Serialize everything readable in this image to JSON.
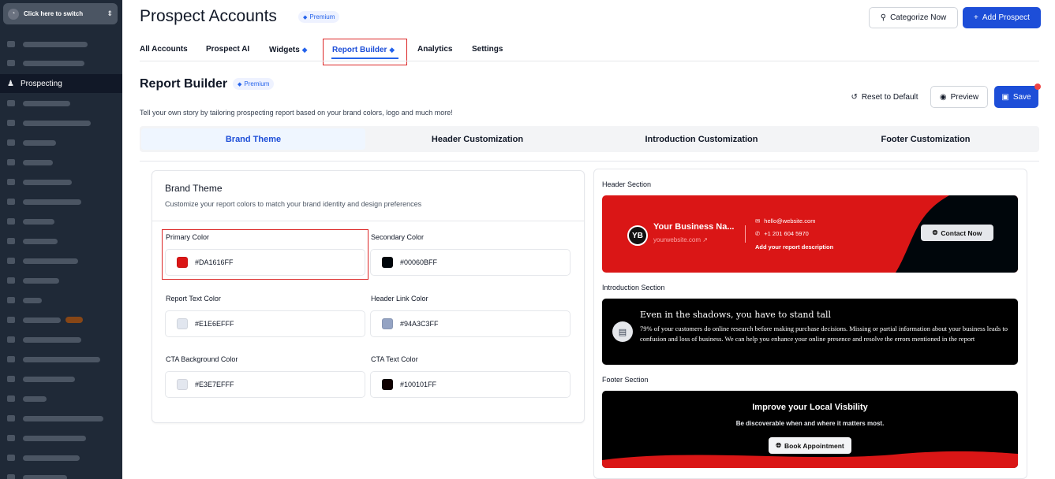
{
  "sidebar": {
    "switcher_label": "Click here to switch",
    "active_item": "Prospecting"
  },
  "page": {
    "title": "Prospect Accounts",
    "premium_badge": "Premium",
    "categorize_label": "Categorize Now",
    "add_prospect_label": "Add Prospect"
  },
  "tabs": [
    {
      "label": "All Accounts"
    },
    {
      "label": "Prospect AI"
    },
    {
      "label": "Widgets"
    },
    {
      "label": "Report Builder"
    },
    {
      "label": "Analytics"
    },
    {
      "label": "Settings"
    }
  ],
  "report_builder": {
    "title": "Report Builder",
    "premium_badge": "Premium",
    "description": "Tell your own story by tailoring prospecting report based on your brand colors, logo and much more!",
    "reset_label": "Reset to Default",
    "preview_label": "Preview",
    "save_label": "Save"
  },
  "subtabs": [
    {
      "label": "Brand Theme"
    },
    {
      "label": "Header Customization"
    },
    {
      "label": "Introduction Customization"
    },
    {
      "label": "Footer Customization"
    }
  ],
  "brand_theme": {
    "title": "Brand Theme",
    "subtitle": "Customize your report colors to match your brand identity and design preferences",
    "fields": [
      {
        "label": "Primary Color",
        "value": "#DA1616FF",
        "swatch": "#da1616"
      },
      {
        "label": "Secondary Color",
        "value": "#00060BFF",
        "swatch": "#00060b"
      },
      {
        "label": "Report Text Color",
        "value": "#E1E6EFFF",
        "swatch": "#e1e6ef"
      },
      {
        "label": "Header Link Color",
        "value": "#94A3C3FF",
        "swatch": "#94a3c3"
      },
      {
        "label": "CTA Background Color",
        "value": "#E3E7EFFF",
        "swatch": "#e3e7ef"
      },
      {
        "label": "CTA Text Color",
        "value": "#100101FF",
        "swatch": "#100101"
      }
    ]
  },
  "preview": {
    "header_label": "Header Section",
    "intro_label": "Introduction Section",
    "footer_label": "Footer Section",
    "header": {
      "logo_initials": "YB",
      "business_name": "Your Business Na...",
      "website": "yourwebsite.com",
      "email": "hello@website.com",
      "phone": "+1 201 604 5970",
      "description": "Add your report description",
      "contact_label": "Contact Now"
    },
    "intro": {
      "title": "Even in the shadows, you have to stand tall",
      "text": "79% of your customers do online research before making purchase decisions. Missing or partial information about your business leads to confusion and loss of business. We can help you enhance your online presence and resolve the errors mentioned in the report"
    },
    "footer": {
      "title": "Improve your Local Visbility",
      "subtitle": "Be discoverable when and where it matters most.",
      "cta_label": "Book Appointment"
    }
  },
  "colors": {
    "accent": "#1d4ed8",
    "highlight": "#dc2626",
    "sidebar_bg": "#1f2937"
  }
}
